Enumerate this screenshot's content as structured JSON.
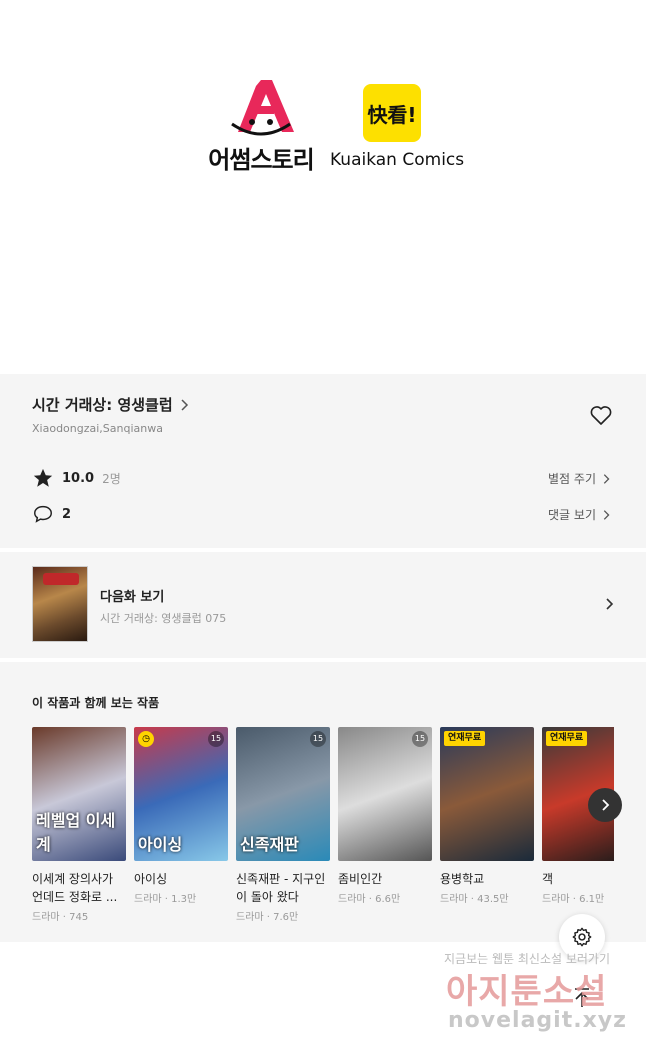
{
  "hero": {
    "awesome_logo_text": "어썸스토리",
    "kuaikan_box_text": "快看!",
    "kuaikan_text": "Kuaikan Comics"
  },
  "series": {
    "title": "시간 거래상: 영생클럽",
    "authors": "Xiaodongzai,Sanqianwa",
    "rating": "10.0",
    "rating_count": "2명",
    "rate_link": "별점 주기",
    "comment_count": "2",
    "comment_link": "댓글 보기"
  },
  "next_episode": {
    "label": "다음화 보기",
    "subtitle": "시간 거래상: 영생클럽 075"
  },
  "related": {
    "heading": "이 작품과 함께 보는 작품",
    "items": [
      {
        "title": "이세계 장의사가 언데드 정화로 ...",
        "meta": "드라마 · 745",
        "cover_text": "레벨업 이세계",
        "colors": [
          "#6a3a2a",
          "#c8c8d8",
          "#3a4a7a"
        ]
      },
      {
        "title": "아이싱",
        "meta": "드라마 · 1.3만",
        "cover_text": "아이싱",
        "badge": "clock",
        "age": "15",
        "colors": [
          "#c83a4a",
          "#3a6ab8",
          "#88c8e8"
        ]
      },
      {
        "title": "신족재판 - 지구인이 돌아 왔다",
        "meta": "드라마 · 7.6만",
        "cover_text": "신족재판",
        "age": "15",
        "colors": [
          "#4a5a6a",
          "#8898a8",
          "#2a8ab8"
        ]
      },
      {
        "title": "좀비인간",
        "meta": "드라마 · 6.6만",
        "cover_text": "",
        "age": "15",
        "colors": [
          "#888888",
          "#dddddd",
          "#555555"
        ]
      },
      {
        "title": "용병학교",
        "meta": "드라마 · 43.5만",
        "cover_text": "",
        "badge_text": "연재무료",
        "colors": [
          "#2a3a5a",
          "#8a5a3a",
          "#1a2a3a"
        ]
      },
      {
        "title": "객",
        "meta": "드라마 · 6.1만",
        "cover_text": "",
        "badge_text": "연재무료",
        "colors": [
          "#3a3a3a",
          "#c83a2a",
          "#1a1a1a"
        ]
      }
    ]
  },
  "watermark": {
    "line1": "지금보는 웹툰 최신소설 보러가기",
    "line2": "아지툰소설",
    "line3": "novelagit.xyz"
  }
}
